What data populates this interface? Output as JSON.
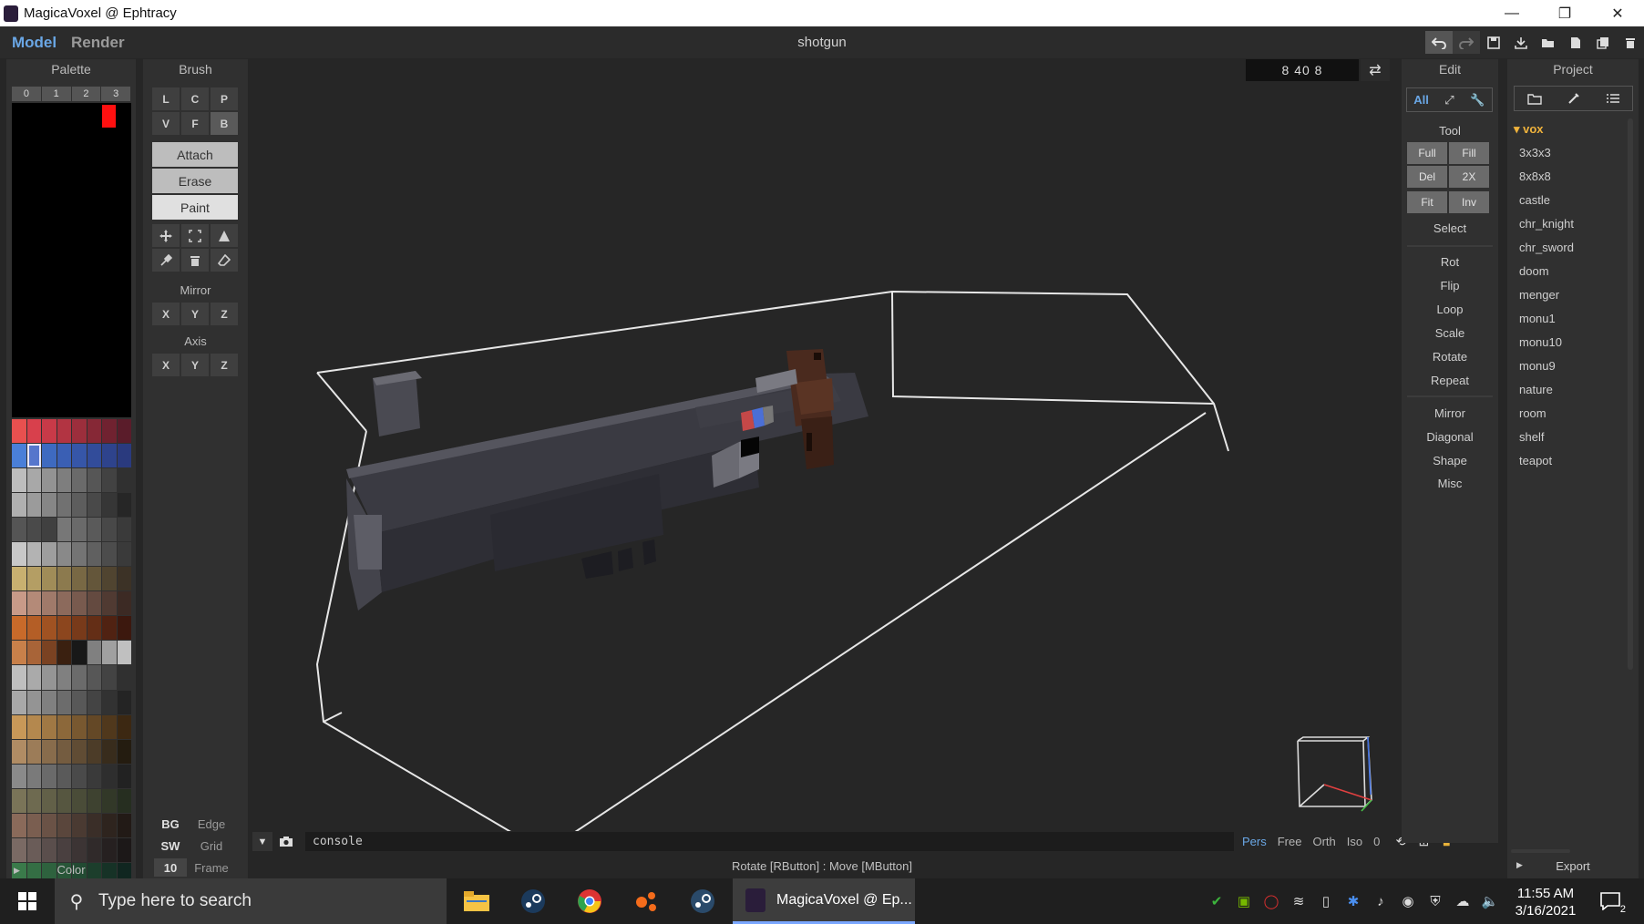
{
  "window": {
    "title": "MagicaVoxel @ Ephtracy",
    "minimize_glyph": "—",
    "restore_glyph": "❐",
    "close_glyph": "✕"
  },
  "menubar": {
    "model_label": "Model",
    "render_label": "Render",
    "file_title": "shotgun",
    "toolbar_icons": [
      "undo-icon",
      "redo-icon",
      "save-icon",
      "save-as-icon",
      "open-icon",
      "new-icon",
      "copy-icon",
      "delete-icon"
    ]
  },
  "palette": {
    "title": "Palette",
    "tabs": [
      "0",
      "1",
      "2",
      "3"
    ],
    "footer": "Color",
    "selected_swatch_row": 1,
    "selected_swatch_col": 1,
    "rows": [
      [
        "#e8504f",
        "#d8404c",
        "#c83a48",
        "#b23442",
        "#9c2e3c",
        "#862836",
        "#702230",
        "#5a1c2a"
      ],
      [
        "#4a7fd8",
        "#5676cc",
        "#3e6ac0",
        "#3a5fb4",
        "#3656a8",
        "#324c9a",
        "#2e438c",
        "#2a3a7e"
      ],
      [
        "#bdbdbd",
        "#a8a8a8",
        "#939393",
        "#7e7e7e",
        "#6a6a6a",
        "#565656",
        "#424242",
        "#303030"
      ],
      [
        "#b0b0b0",
        "#9b9b9b",
        "#868686",
        "#717171",
        "#5d5d5d",
        "#494949",
        "#363636",
        "#262626"
      ],
      [
        "#555555",
        "#4a4a4a",
        "#404040",
        "#777777",
        "#6a6a6a",
        "#5a5a5a",
        "#484848",
        "#3a3a3a"
      ],
      [
        "#c8c8c8",
        "#b3b3b3",
        "#9e9e9e",
        "#898989",
        "#747474",
        "#606060",
        "#4c4c4c",
        "#3a3a3a"
      ],
      [
        "#c8b070",
        "#b49e64",
        "#a08c58",
        "#8c7a4e",
        "#786844",
        "#64563a",
        "#504430",
        "#3c3226"
      ],
      [
        "#c89a88",
        "#b48a78",
        "#a07a6a",
        "#8c6a5c",
        "#785a4e",
        "#644a40",
        "#503a32",
        "#3c2a24"
      ],
      [
        "#c86a2a",
        "#b45e26",
        "#a05222",
        "#8c461e",
        "#783a1a",
        "#642e16",
        "#502212",
        "#3c180e"
      ],
      [
        "#c8804a",
        "#a86438",
        "#7a4222",
        "#3a2010",
        "#181818",
        "#808080",
        "#a0a0a0",
        "#c0c0c0"
      ],
      [
        "#bfbfbf",
        "#aaaaaa",
        "#959595",
        "#808080",
        "#6b6b6b",
        "#575757",
        "#434343",
        "#303030"
      ],
      [
        "#a8a8a8",
        "#949494",
        "#808080",
        "#6c6c6c",
        "#585858",
        "#444444",
        "#323232",
        "#242424"
      ],
      [
        "#c89858",
        "#b4884e",
        "#a07844",
        "#8c683a",
        "#785830",
        "#644826",
        "#50381c",
        "#3c2812"
      ],
      [
        "#b08c64",
        "#9c7c58",
        "#886c4c",
        "#745c40",
        "#604c34",
        "#4c3c28",
        "#382c1c",
        "#241c10"
      ],
      [
        "#8a8a8a",
        "#7a7a7a",
        "#6a6a6a",
        "#5a5a5a",
        "#4a4a4a",
        "#3a3a3a",
        "#2e2e2e",
        "#222222"
      ],
      [
        "#7a7458",
        "#6e6a50",
        "#626048",
        "#565640",
        "#4a4c38",
        "#3e4230",
        "#323828",
        "#262e20"
      ],
      [
        "#8a6a5a",
        "#7a5e50",
        "#6a5246",
        "#5a463c",
        "#4a3a32",
        "#3a2e28",
        "#2e241e",
        "#221a16"
      ],
      [
        "#7a6a64",
        "#6a5c58",
        "#5a4e4c",
        "#4a4040",
        "#3c3434",
        "#302a2a",
        "#262020",
        "#1c1818"
      ],
      [
        "#3a7a4a",
        "#346e44",
        "#2e623e",
        "#285638",
        "#224a32",
        "#1c3e2c",
        "#163226",
        "#102620"
      ],
      [
        "#4a8a4a",
        "#427e42",
        "#3a723a",
        "#326632",
        "#2a5a2a",
        "#224e22",
        "#1a421a",
        "#123612"
      ],
      [
        "#8a6a5a",
        "#6a5a3a",
        "#3a8a5a",
        "#3a7a8a",
        "#3a5a9a",
        "#5a4a9a",
        "#7a3a8a",
        "#9a3a7a"
      ]
    ]
  },
  "brush": {
    "title": "Brush",
    "row1": [
      "L",
      "C",
      "P"
    ],
    "row2": [
      "V",
      "F",
      "B"
    ],
    "selected_shape": "B",
    "attach": "Attach",
    "erase": "Erase",
    "paint": "Paint",
    "active_mode": "Paint",
    "tool_icons_row1": [
      "move-icon",
      "select-box-icon",
      "face-icon"
    ],
    "tool_icons_row2": [
      "eyedropper-icon",
      "trash-icon",
      "eraser-icon"
    ],
    "mirror_label": "Mirror",
    "mirror": [
      "X",
      "Y",
      "Z"
    ],
    "axis_label": "Axis",
    "axis": [
      "X",
      "Y",
      "Z"
    ],
    "bg_label": "BG",
    "edge_label": "Edge",
    "sw_label": "SW",
    "grid_label": "Grid",
    "frame_value": "10",
    "frame_label": "Frame"
  },
  "viewport": {
    "coords": "8  40  8",
    "swap_glyph": "⇄",
    "console_arrow": "▼",
    "console_placeholder": "console",
    "views": [
      "Pers",
      "Free",
      "Orth",
      "Iso"
    ],
    "active_view": "Pers",
    "zero_value": "0",
    "status": "Rotate [RButton] : Move [MButton]"
  },
  "edit": {
    "title": "Edit",
    "all_label": "All",
    "tool_label": "Tool",
    "tool_grid": [
      [
        "Full",
        "Fill"
      ],
      [
        "Del",
        "2X"
      ],
      [
        "Fit",
        "Inv"
      ]
    ],
    "select_label": "Select",
    "group1": [
      "Rot",
      "Flip",
      "Loop",
      "Scale",
      "Rotate",
      "Repeat"
    ],
    "group2": [
      "Mirror",
      "Diagonal",
      "Shape",
      "Misc"
    ]
  },
  "project": {
    "title": "Project",
    "folder": "vox",
    "files": [
      "3x3x3",
      "8x8x8",
      "castle",
      "chr_knight",
      "chr_sword",
      "doom",
      "menger",
      "monu1",
      "monu10",
      "monu9",
      "nature",
      "room",
      "shelf",
      "teapot"
    ],
    "export_label": "Export"
  },
  "taskbar": {
    "search_placeholder": "Type here to search",
    "active_app": "MagicaVoxel @ Ep...",
    "time": "11:55 AM",
    "date": "3/16/2021",
    "notification_count": "2"
  }
}
